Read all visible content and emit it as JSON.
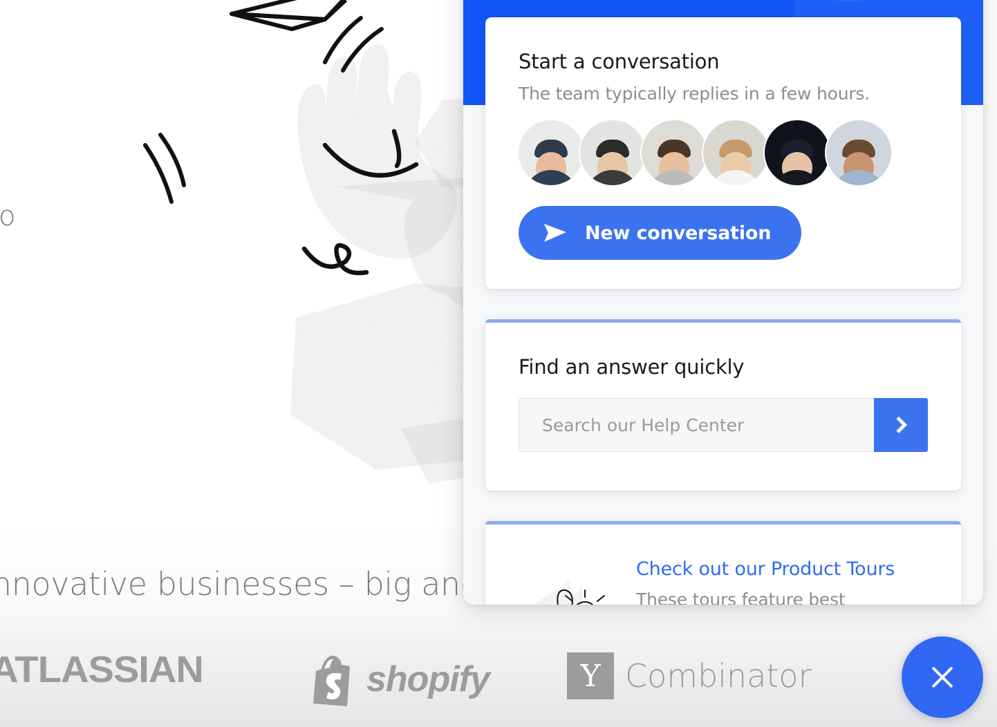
{
  "background_page": {
    "partial_word_left": "o",
    "tagline_partial": "nnovative businesses – big and",
    "logos": [
      {
        "name": "atlassian",
        "label": "ATLASSIAN"
      },
      {
        "name": "shopify",
        "label": "shopify"
      },
      {
        "name": "ycombinator",
        "label": "Combinator",
        "mark": "Y"
      }
    ]
  },
  "messenger": {
    "header_color": "#1157f6",
    "accent_color": "#3b72f0",
    "card_topline_color": "#8aa9f0",
    "conversation_card": {
      "title": "Start a conversation",
      "subtitle": "The team typically replies in a few hours.",
      "new_conversation_label": "New conversation",
      "send_icon": "paper-plane-icon",
      "teammates": [
        {
          "name": "teammate-1",
          "skin": "#e8bb9a",
          "hair": "#2d3b4a",
          "shirt": "#2f3f53",
          "bg": "#e9ebe8"
        },
        {
          "name": "teammate-2",
          "skin": "#e7c6a4",
          "hair": "#2a2a2a",
          "shirt": "#3b3b3b",
          "bg": "#e3e3e1"
        },
        {
          "name": "teammate-3",
          "skin": "#e9bf9c",
          "hair": "#4a3627",
          "shirt": "#b9bcbd",
          "bg": "#dedcd6"
        },
        {
          "name": "teammate-4",
          "skin": "#eccaa8",
          "hair": "#c59b6d",
          "shirt": "#f4f4f2",
          "bg": "#d9d8cf"
        },
        {
          "name": "teammate-5",
          "skin": "#e6c3a6",
          "hair": "#1b1f2b",
          "shirt": "#141820",
          "bg": "#10131b"
        },
        {
          "name": "teammate-6",
          "skin": "#c89470",
          "hair": "#6b4a32",
          "shirt": "#9fb6d0",
          "bg": "#cfd6dd"
        }
      ]
    },
    "search_card": {
      "title": "Find an answer quickly",
      "input_value": "",
      "input_placeholder": "Search our Help Center",
      "submit_icon": "chevron-right-icon"
    },
    "tours_card": {
      "link_label": "Check out our Product Tours",
      "description": "These tours feature best",
      "thumbnail_icon": "product-tour-illustration"
    },
    "close_button": {
      "icon": "close-x-icon",
      "color": "#3068f5"
    }
  }
}
